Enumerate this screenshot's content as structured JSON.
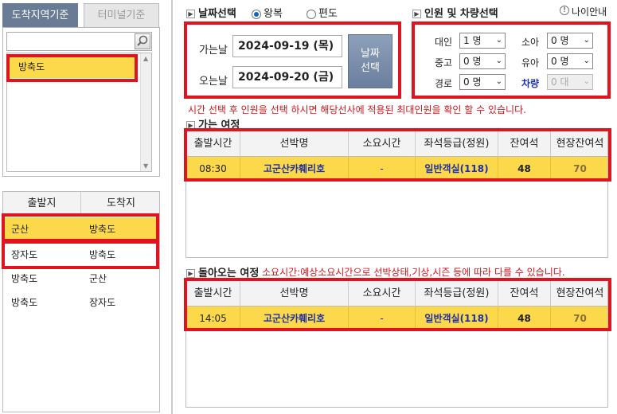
{
  "left_tabs": {
    "active": "도착지역기준",
    "inactive": "터미널기준"
  },
  "search": {
    "value": "",
    "placeholder": ""
  },
  "region_list": [
    "방축도"
  ],
  "route_table": {
    "headers": [
      "출발지",
      "도착지"
    ],
    "rows": [
      {
        "from": "군산",
        "to": "방축도"
      },
      {
        "from": "장자도",
        "to": "방축도"
      },
      {
        "from": "방축도",
        "to": "군산"
      },
      {
        "from": "방축도",
        "to": "장자도"
      }
    ]
  },
  "date_section": {
    "title": "날짜선택",
    "trip_round": "왕복",
    "trip_oneway": "편도",
    "depart_label": "가는날",
    "depart_value": "2024-09-19 (목)",
    "return_label": "오는날",
    "return_value": "2024-09-20 (금)",
    "button": [
      "날짜",
      "선택"
    ]
  },
  "passenger_section": {
    "title": "인원 및 차량선택",
    "age_guide": "나이안내",
    "adult_label": "대인",
    "adult_value": "1 명",
    "middle_label": "중고",
    "middle_value": "0 명",
    "senior_label": "경로",
    "senior_value": "0 명",
    "child_label": "소아",
    "child_value": "0 명",
    "infant_label": "유아",
    "infant_value": "0 명",
    "vehicle_label": "차량",
    "vehicle_value": "0 대"
  },
  "notice": "시간 선택 후 인원을 선택 하시면 해당선사에 적용된 최대인원을 확인 할 수 있습니다.",
  "outbound": {
    "title": "가는 여정",
    "headers": [
      "출발시간",
      "선박명",
      "소요시간",
      "좌석등급(정원)",
      "잔여석",
      "현장잔여석"
    ],
    "row": {
      "time": "08:30",
      "ship": "고군산카훼리호",
      "duration": "-",
      "grade": "일반객실(118)",
      "remaining": "48",
      "onsite": "70"
    }
  },
  "return_trip": {
    "title": "돌아오는 여정",
    "note": "소요시간:예상소요시간으로 선박상태,기상,시즌 등에 따라 다를 수 있습니다.",
    "headers": [
      "출발시간",
      "선박명",
      "소요시간",
      "좌석등급(정원)",
      "잔여석",
      "현장잔여석"
    ],
    "row": {
      "time": "14:05",
      "ship": "고군산카훼리호",
      "duration": "-",
      "grade": "일반객실(118)",
      "remaining": "48",
      "onsite": "70"
    }
  },
  "colors": {
    "highlight": "#fcd94a",
    "red_outline": "#e0141e",
    "tab_active": "#6a7c95",
    "link": "#1d2fa8"
  }
}
